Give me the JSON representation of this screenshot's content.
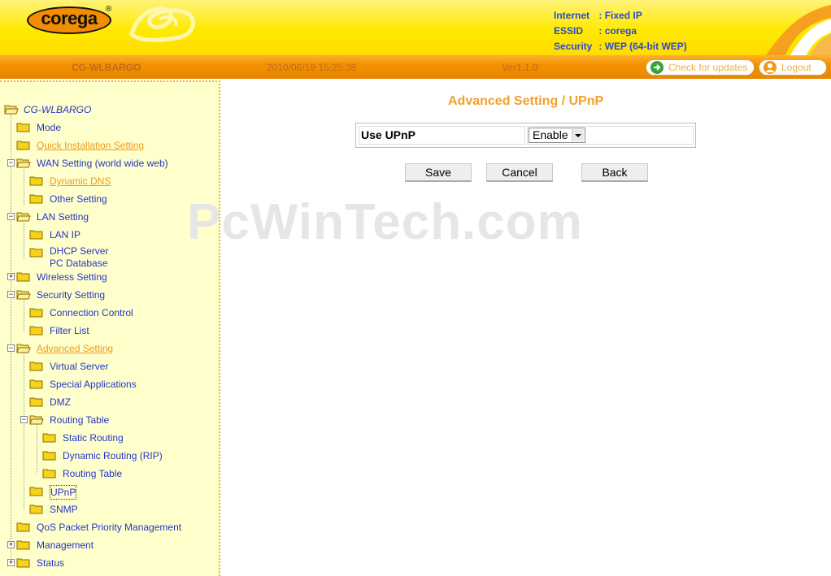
{
  "header": {
    "logo_text": "corega",
    "logo_reg": "®",
    "info": [
      {
        "key": "Internet",
        "sep": ":",
        "value": "Fixed IP"
      },
      {
        "key": "ESSID",
        "sep": ":",
        "value": "corega"
      },
      {
        "key": "Security",
        "sep": ":",
        "value": "WEP (64-bit WEP)"
      }
    ]
  },
  "statusbar": {
    "device": "CG-WLBARGO",
    "datetime": "2010/06/19 15:25:38",
    "version": "Ver1.1.0",
    "check_updates": "Check for updates",
    "logout": "Logout"
  },
  "sidebar": {
    "root": "CG-WLBARGO",
    "items": [
      {
        "label": "Mode"
      },
      {
        "label": "Quick Installation Setting"
      },
      {
        "label": "WAN Setting (world wide web)"
      },
      {
        "label": "Dynamic DNS"
      },
      {
        "label": "Other Setting"
      },
      {
        "label": "LAN Setting"
      },
      {
        "label": "LAN IP"
      },
      {
        "label": "DHCP Server"
      },
      {
        "label": "PC Database"
      },
      {
        "label": "Wireless Setting"
      },
      {
        "label": "Security Setting"
      },
      {
        "label": "Connection Control"
      },
      {
        "label": "Filter List"
      },
      {
        "label": "Advanced Setting"
      },
      {
        "label": "Virtual Server"
      },
      {
        "label": "Special Applications"
      },
      {
        "label": "DMZ"
      },
      {
        "label": "Routing Table"
      },
      {
        "label": "Static Routing"
      },
      {
        "label": "Dynamic Routing (RIP)"
      },
      {
        "label": "Routing Table"
      },
      {
        "label": "UPnP"
      },
      {
        "label": "SNMP"
      },
      {
        "label": "QoS Packet Priority Management"
      },
      {
        "label": "Management"
      },
      {
        "label": "Status"
      }
    ]
  },
  "main": {
    "title": "Advanced Setting / UPnP",
    "watermark": "PcWinTech.com",
    "form": {
      "label": "Use UPnP",
      "select_value": "Enable"
    },
    "buttons": {
      "save": "Save",
      "cancel": "Cancel",
      "back": "Back"
    }
  },
  "colors": {
    "header_yellow": "#ffe900",
    "statusbar_orange": "#f29200",
    "sidebar_bg": "#ffffcc",
    "link_blue": "#2336c8",
    "active_orange": "#f09a1a",
    "title_orange": "#f2a12d"
  }
}
